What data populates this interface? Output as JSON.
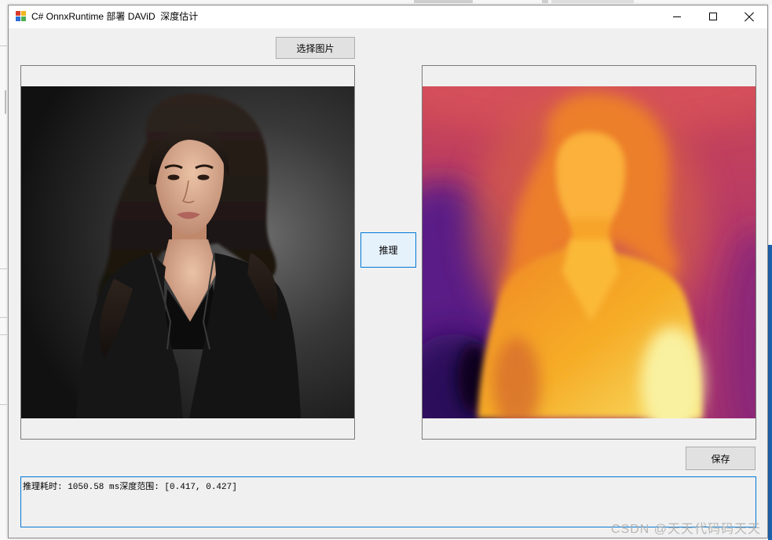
{
  "window": {
    "title": "C# OnnxRuntime 部署 DAViD  深度估计"
  },
  "toolbar": {
    "select_image_label": "选择图片"
  },
  "actions": {
    "infer_label": "推理",
    "save_label": "保存"
  },
  "output": {
    "text": "推理耗时: 1050.58 ms深度范围: [0.417, 0.427]"
  },
  "watermark": {
    "text": "CSDN @天天代码码天天"
  },
  "icons": {
    "app": "app-icon",
    "minimize": "minimize-icon",
    "maximize": "maximize-icon",
    "close": "close-icon"
  },
  "colors": {
    "form_background": "#f0f0f0",
    "title_bar": "#ffffff",
    "button_background": "#e1e1e1",
    "button_border": "#adadad",
    "focus_background": "#e5f1fb",
    "focus_border": "#0078d7"
  }
}
